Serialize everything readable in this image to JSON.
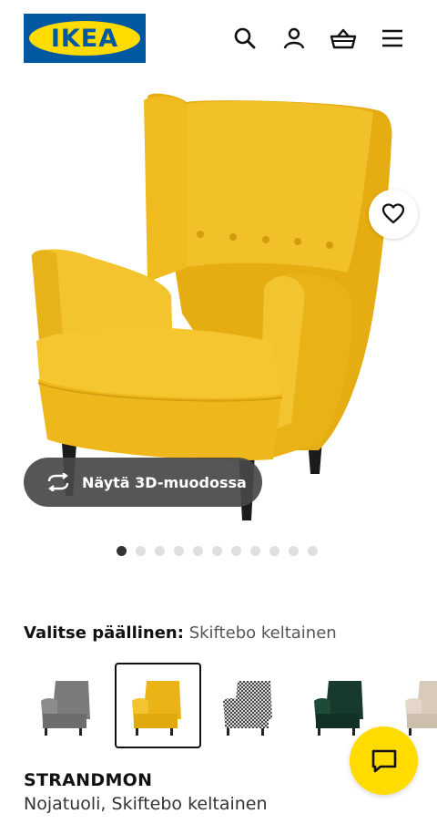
{
  "header": {
    "logo_text": "IKEA",
    "icons": [
      "search-icon",
      "account-icon",
      "basket-icon",
      "menu-icon"
    ]
  },
  "hero": {
    "favourite_icon": "heart-icon",
    "view_3d_label": "Näytä 3D-muodossa",
    "view_3d_icon": "rotate-icon"
  },
  "carousel": {
    "total": 11,
    "active_index": 0
  },
  "cover": {
    "label": "Valitse päällinen:",
    "value": "Skiftebo keltainen",
    "swatches": [
      {
        "name": "grey",
        "color": "#7a7b7d",
        "selected": false
      },
      {
        "name": "yellow",
        "color": "#f0bb1b",
        "selected": true
      },
      {
        "name": "check",
        "color": "#9a9a9a",
        "selected": false
      },
      {
        "name": "green",
        "color": "#173a2c",
        "selected": false
      },
      {
        "name": "beige",
        "color": "#d8cbbb",
        "selected": false
      }
    ]
  },
  "product": {
    "name": "STRANDMON",
    "description": "Nojatuoli, Skiftebo keltainen"
  },
  "colors": {
    "brand_blue": "#0058a3",
    "brand_yellow": "#ffdb00",
    "chair_yellow": "#f2bf1f"
  },
  "chat_icon": "chat-icon"
}
